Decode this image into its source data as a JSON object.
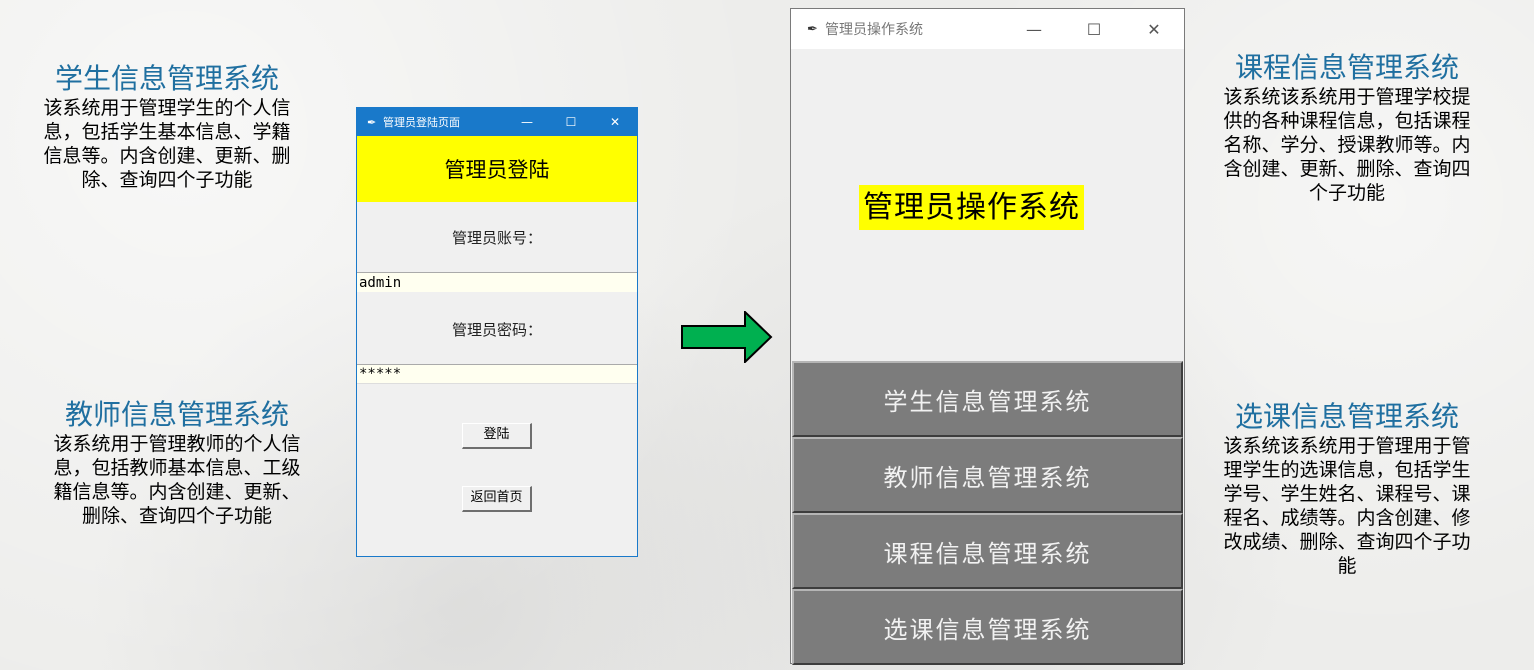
{
  "descriptions": {
    "student": {
      "title": "学生信息管理系统",
      "lines": [
        "该系统用于管理学生的个人信",
        "息，包括学生基本信息、学籍",
        "信息等。内含创建、更新、删",
        "除、查询四个子功能"
      ]
    },
    "teacher": {
      "title": "教师信息管理系统",
      "lines": [
        "该系统用于管理教师的个人信",
        "息，包括教师基本信息、工级",
        "籍信息等。内含创建、更新、",
        "删除、查询四个子功能"
      ]
    },
    "course": {
      "title": "课程信息管理系统",
      "lines": [
        "该系统该系统用于管理学校提",
        "供的各种课程信息，包括课程",
        "名称、学分、授课教师等。内",
        "含创建、更新、删除、查询四",
        "个子功能"
      ]
    },
    "selection": {
      "title": "选课信息管理系统",
      "lines": [
        "该系统该系统用于管理用于管",
        "理学生的选课信息，包括学生",
        "学号、学生姓名、课程号、课",
        "程名、成绩等。内含创建、修",
        "改成绩、删除、查询四个子功",
        "能"
      ]
    }
  },
  "login_window": {
    "title": "管理员登陆页面",
    "controls": {
      "minimize": "—",
      "maximize": "☐",
      "close": "✕"
    },
    "banner": "管理员登陆",
    "account_label": "管理员账号：",
    "account_value": "admin",
    "password_label": "管理员密码：",
    "password_value": "*****",
    "login_button": "登陆",
    "home_button": "返回首页"
  },
  "admin_window": {
    "title": "管理员操作系统",
    "controls": {
      "minimize": "—",
      "maximize": "☐",
      "close": "✕"
    },
    "heading": "管理员操作系统",
    "menu": [
      "学生信息管理系统",
      "教师信息管理系统",
      "课程信息管理系统",
      "选课信息管理系统"
    ]
  },
  "icons": {
    "app": "feather-icon",
    "arrow": "arrow-right-icon"
  },
  "colors": {
    "title_text": "#1f6fa0",
    "banner": "#ffff00",
    "arrow_fill": "#00b050",
    "menu_button": "#7c7c7c"
  }
}
